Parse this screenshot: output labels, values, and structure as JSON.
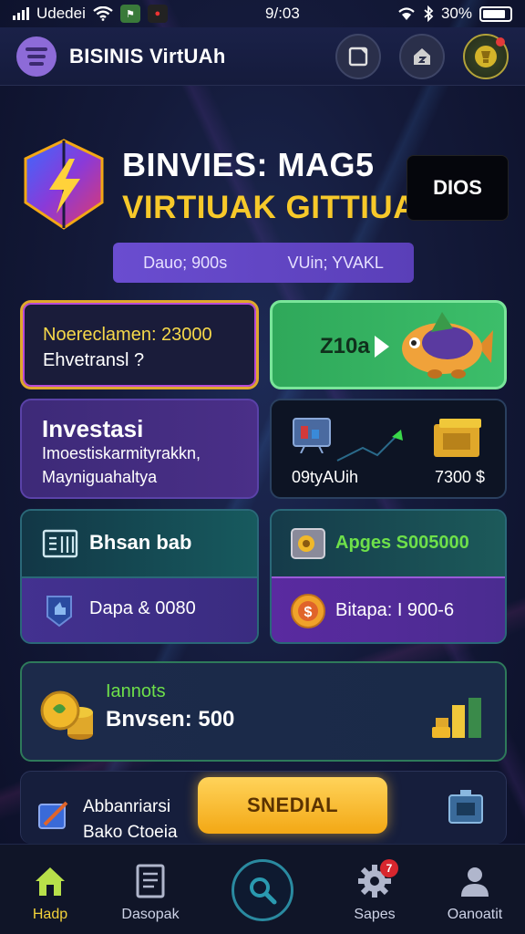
{
  "status_bar": {
    "carrier": "Udedei",
    "time": "9/:03",
    "battery": "30%"
  },
  "header": {
    "title": "BISINIS VirtUAh"
  },
  "hero": {
    "title_line1": "BINVIES: MAG5",
    "title_line2": "VIRTIUAK GITTIUAL",
    "action_button": "DIOS",
    "pill_left": "Dauo; 900s",
    "pill_right": "VUin; YVAKL"
  },
  "cards": {
    "promo": {
      "line1": "Noereclamen: 23000",
      "line2": "Ehvetransl ?"
    },
    "fish": {
      "label": "Z10a"
    },
    "investasi": {
      "title": "Investasi",
      "line1": "Imoestiskarmityrakkn,",
      "line2": "Mayniguahaltya"
    },
    "trend": {
      "left": "09tyAUih",
      "right": "7300 $"
    },
    "bisnis": {
      "title": "Bhsan bab",
      "sub": "Dapa & 0080"
    },
    "apps": {
      "title": "Apges S005000",
      "sub": "Bitapa: I 900-6"
    },
    "balance": {
      "line1": "Iannots",
      "line2": "Bnvsen: 500"
    },
    "special": {
      "line1": "Abbanriarsi",
      "line2": "Bako Ctoeia",
      "button": "SNEDIAL"
    }
  },
  "bottom_nav": {
    "items": [
      {
        "label": "Hadp"
      },
      {
        "label": "Dasopak"
      },
      {
        "label": "Sapes",
        "badge": "7"
      },
      {
        "label": "Oanoatit"
      }
    ]
  },
  "colors": {
    "accent_yellow": "#f7c92a",
    "accent_green": "#6ee04a",
    "purple": "#5a3fb8"
  }
}
